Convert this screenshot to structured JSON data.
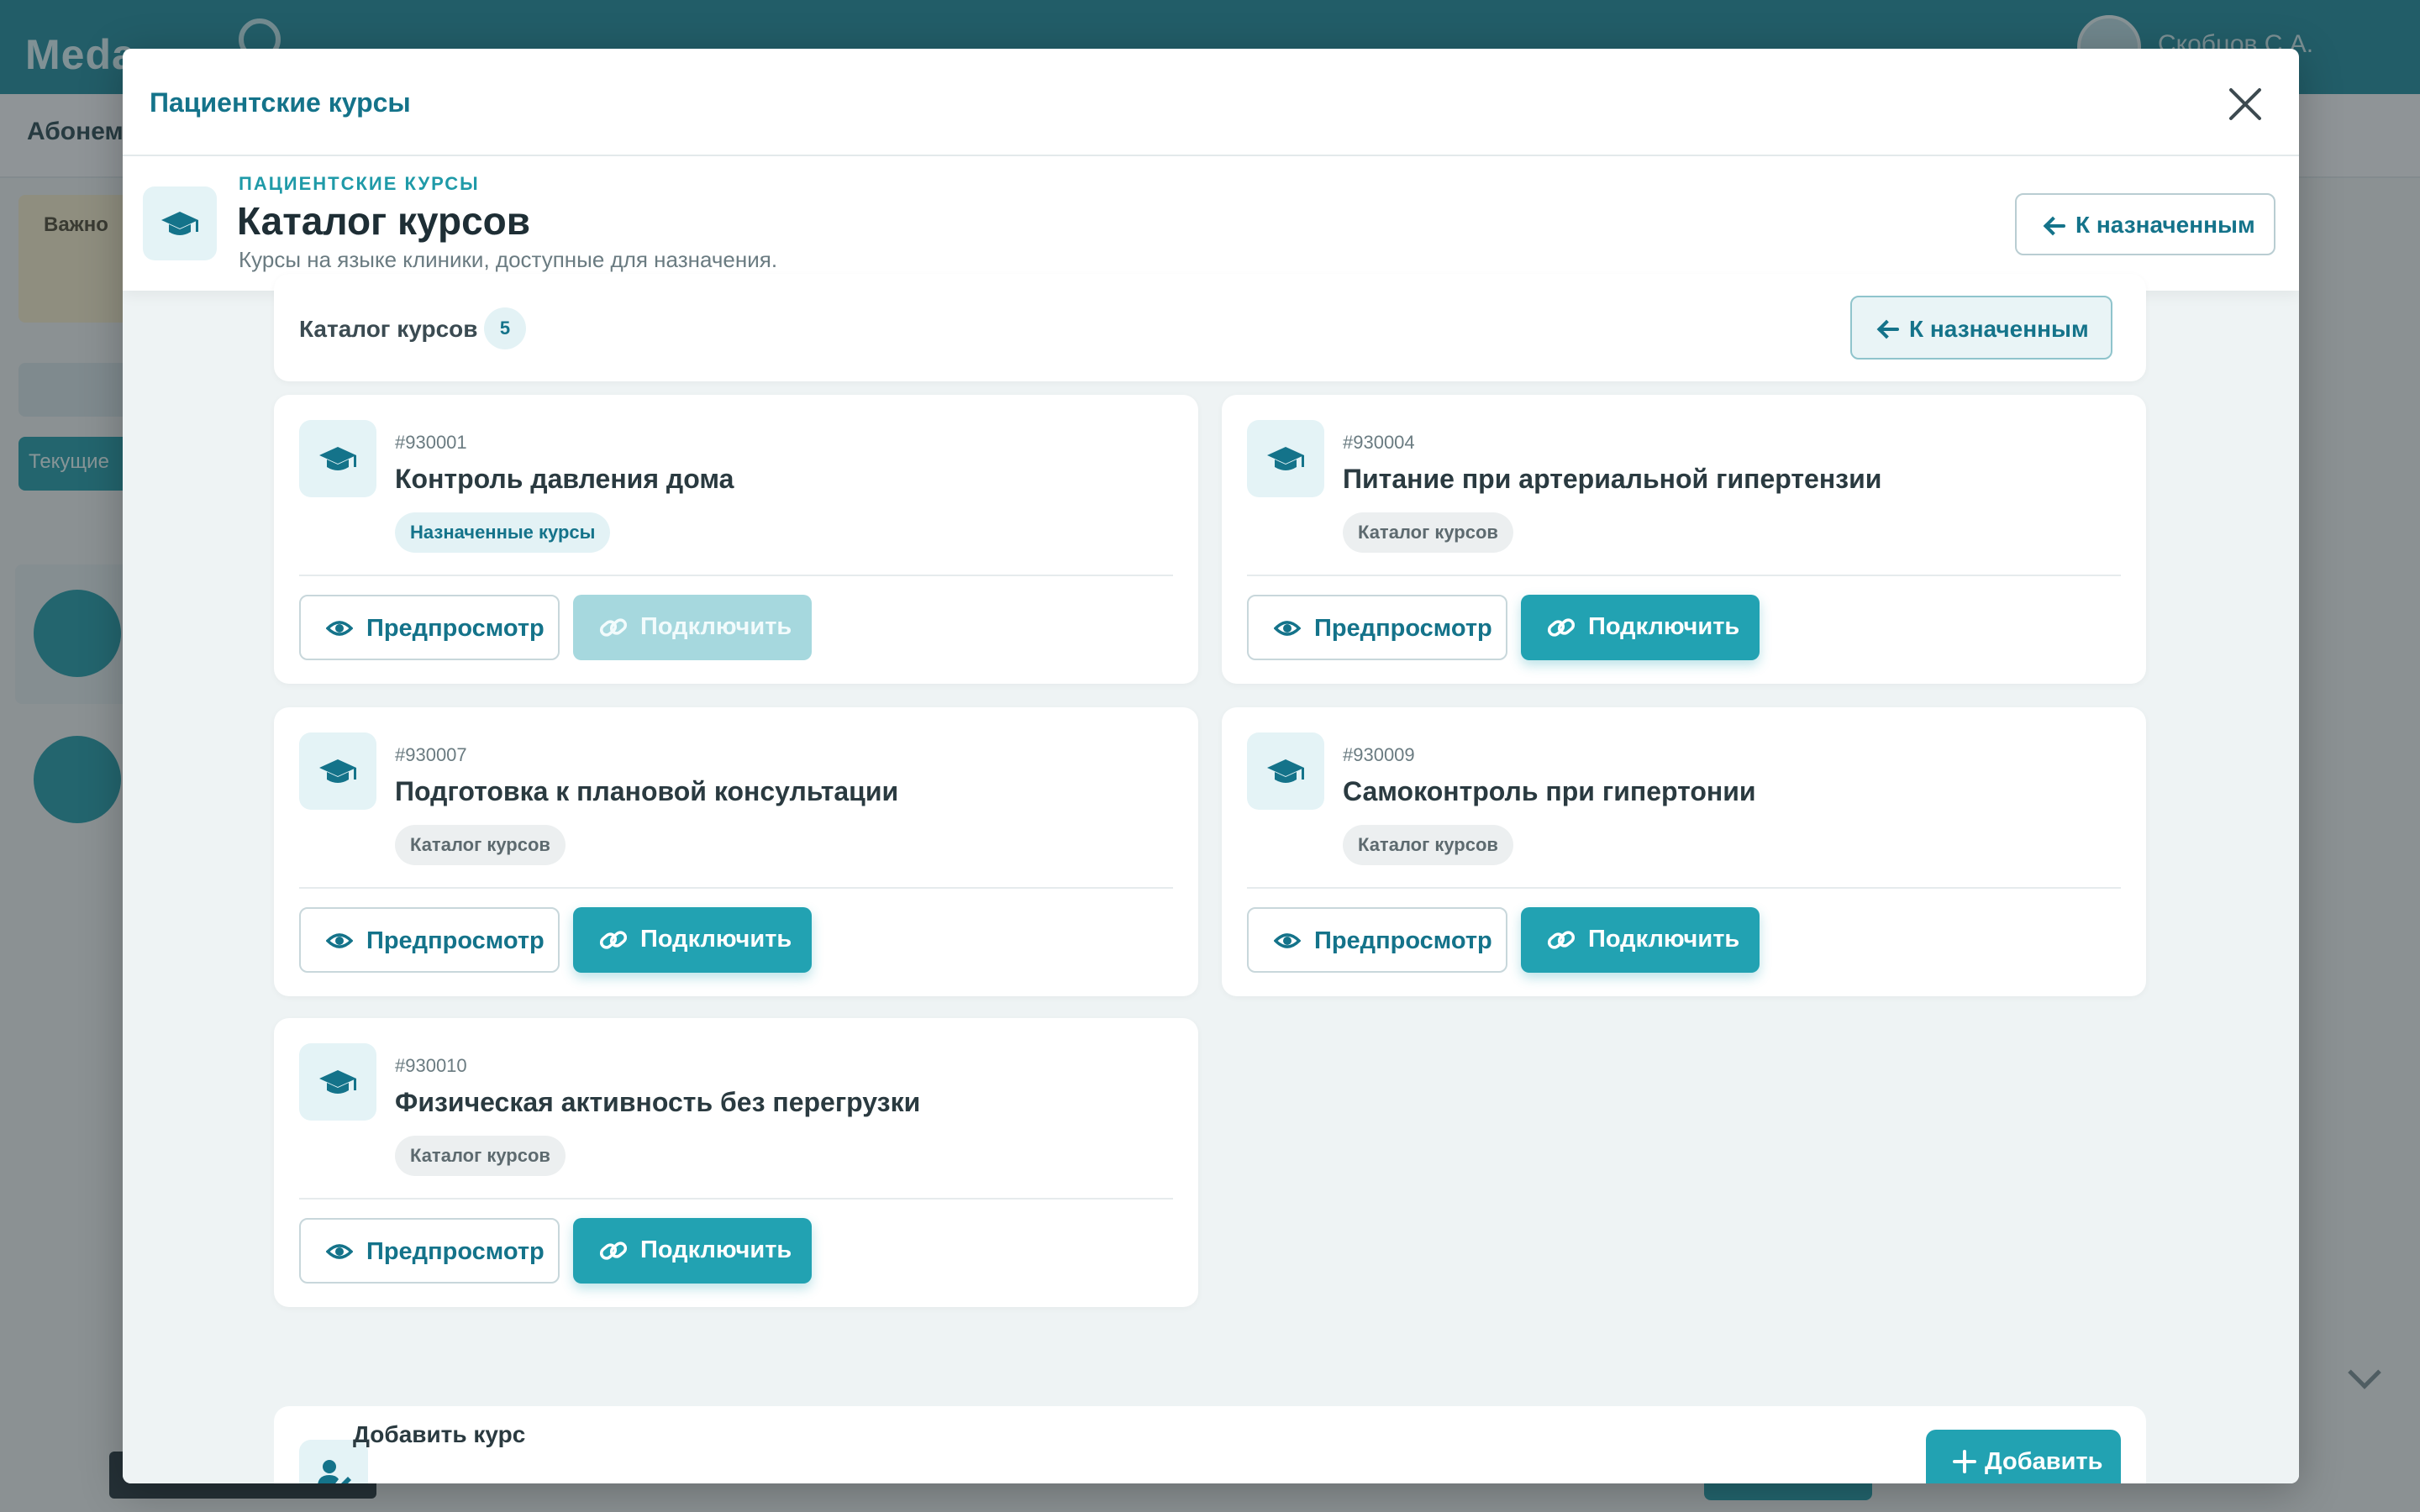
{
  "background": {
    "logo": "Meda",
    "user_name": "Скобцов С.А.",
    "subbar_text": "Абонем",
    "alert_text": "Важно",
    "tab_current": "Текущие"
  },
  "modal": {
    "title": "Пациентские курсы"
  },
  "page_header": {
    "eyebrow": "ПАЦИЕНТСКИЕ КУРСЫ",
    "title": "Каталог курсов",
    "subtitle": "Курсы на языке клиники, доступные для назначения.",
    "back_label": "К назначенным"
  },
  "catalog_bar": {
    "label": "Каталог курсов",
    "count": "5",
    "back_label": "К назначенным"
  },
  "buttons": {
    "preview": "Предпросмотр",
    "connect": "Подключить"
  },
  "courses": [
    {
      "id": "#930001",
      "title": "Контроль давления дома",
      "tag": "Назначенные курсы",
      "connect_enabled": false
    },
    {
      "id": "#930004",
      "title": "Питание при артериальной гипертензии",
      "tag": "Каталог курсов",
      "connect_enabled": true
    },
    {
      "id": "#930007",
      "title": "Подготовка к плановой консультации",
      "tag": "Каталог курсов",
      "connect_enabled": true
    },
    {
      "id": "#930009",
      "title": "Самоконтроль при гипертонии",
      "tag": "Каталог курсов",
      "connect_enabled": true
    },
    {
      "id": "#930010",
      "title": "Физическая активность без перегрузки",
      "tag": "Каталог курсов",
      "connect_enabled": true
    }
  ],
  "add_course": {
    "label": "Добавить курс",
    "button": "Добавить"
  },
  "icons": {
    "course": "graduation-cap-icon",
    "preview": "eye-icon",
    "connect": "link-icon",
    "back": "arrow-left-icon",
    "close": "close-icon",
    "add": "plus-icon",
    "add_course": "user-edit-icon"
  },
  "colors": {
    "accent": "#22a2b2",
    "accent_dark": "#14738a",
    "accent_disabled": "#a6d8de",
    "topbar": "#1c8a9c"
  }
}
